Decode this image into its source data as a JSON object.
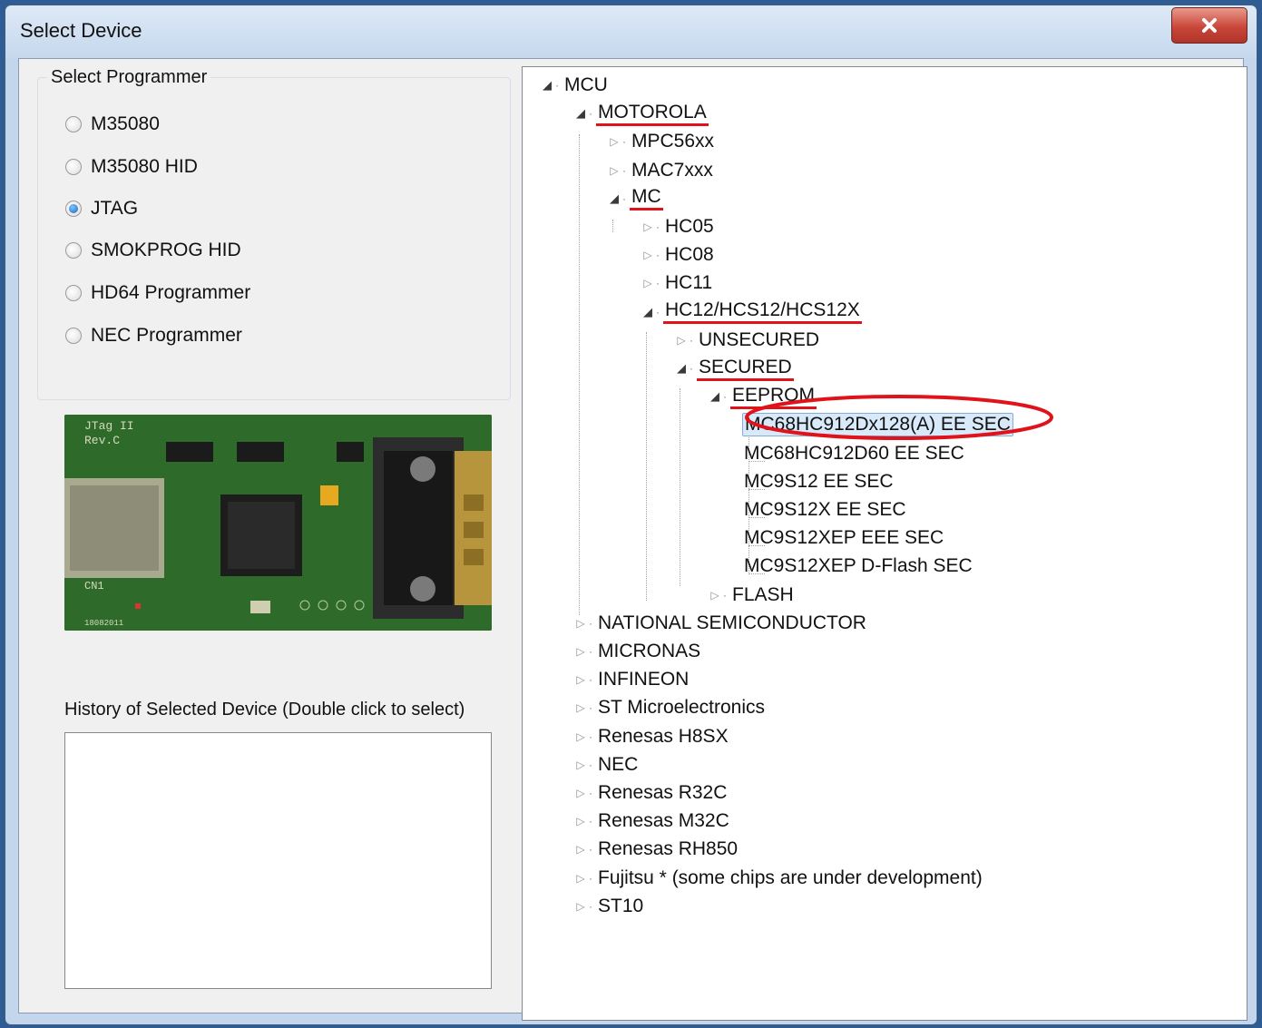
{
  "window": {
    "title": "Select Device"
  },
  "programmer": {
    "legend": "Select Programmer",
    "options": [
      {
        "label": "M35080",
        "checked": false
      },
      {
        "label": "M35080 HID",
        "checked": false
      },
      {
        "label": "JTAG",
        "checked": true
      },
      {
        "label": "SMOKPROG HID",
        "checked": false
      },
      {
        "label": "HD64 Programmer",
        "checked": false
      },
      {
        "label": "NEC Programmer",
        "checked": false
      }
    ]
  },
  "board": {
    "silkscreen_1": "JTag II",
    "silkscreen_2": "Rev.C",
    "silkscreen_3": "CN1",
    "silkscreen_4": "18082011"
  },
  "history": {
    "label": "History of Selected Device (Double click to select)"
  },
  "tree": [
    {
      "label": "MCU",
      "level": 0,
      "state": "expanded"
    },
    {
      "label": "MOTOROLA",
      "level": 1,
      "state": "expanded",
      "marked": true
    },
    {
      "label": "MPC56xx",
      "level": 2,
      "state": "collapsed"
    },
    {
      "label": "MAC7xxx",
      "level": 2,
      "state": "collapsed"
    },
    {
      "label": "MC",
      "level": 2,
      "state": "expanded",
      "marked": true
    },
    {
      "label": "HC05",
      "level": 3,
      "state": "collapsed"
    },
    {
      "label": "HC08",
      "level": 3,
      "state": "collapsed"
    },
    {
      "label": "HC11",
      "level": 3,
      "state": "collapsed"
    },
    {
      "label": "HC12/HCS12/HCS12X",
      "level": 3,
      "state": "expanded",
      "marked": true
    },
    {
      "label": "UNSECURED",
      "level": 4,
      "state": "collapsed"
    },
    {
      "label": "SECURED",
      "level": 4,
      "state": "expanded",
      "marked": true
    },
    {
      "label": "EEPROM",
      "level": 5,
      "state": "expanded",
      "marked": true
    },
    {
      "label": "MC68HC912Dx128(A) EE SEC",
      "level": 6,
      "state": "leaf",
      "selected": true,
      "circled": true
    },
    {
      "label": "MC68HC912D60 EE SEC",
      "level": 6,
      "state": "leaf"
    },
    {
      "label": "MC9S12 EE SEC",
      "level": 6,
      "state": "leaf"
    },
    {
      "label": "MC9S12X EE SEC",
      "level": 6,
      "state": "leaf"
    },
    {
      "label": "MC9S12XEP EEE SEC",
      "level": 6,
      "state": "leaf"
    },
    {
      "label": "MC9S12XEP D-Flash SEC",
      "level": 6,
      "state": "leaf"
    },
    {
      "label": "FLASH",
      "level": 5,
      "state": "collapsed"
    },
    {
      "label": "NATIONAL SEMICONDUCTOR",
      "level": 1,
      "state": "collapsed"
    },
    {
      "label": "MICRONAS",
      "level": 1,
      "state": "collapsed"
    },
    {
      "label": "INFINEON",
      "level": 1,
      "state": "collapsed"
    },
    {
      "label": "ST Microelectronics",
      "level": 1,
      "state": "collapsed"
    },
    {
      "label": "Renesas H8SX",
      "level": 1,
      "state": "collapsed"
    },
    {
      "label": "NEC",
      "level": 1,
      "state": "collapsed"
    },
    {
      "label": "Renesas R32C",
      "level": 1,
      "state": "collapsed"
    },
    {
      "label": "Renesas M32C",
      "level": 1,
      "state": "collapsed"
    },
    {
      "label": "Renesas RH850",
      "level": 1,
      "state": "collapsed"
    },
    {
      "label": "Fujitsu * (some chips are under development)",
      "level": 1,
      "state": "collapsed"
    },
    {
      "label": "ST10",
      "level": 1,
      "state": "collapsed"
    }
  ],
  "colors": {
    "annotation": "#e0131b",
    "selection": "#d8eaf9",
    "titlebar": "#c6d8ee",
    "close_button": "#c9463a"
  },
  "icons": {
    "close": "close-icon",
    "expanded": "triangle-down-icon",
    "collapsed": "triangle-right-icon"
  }
}
